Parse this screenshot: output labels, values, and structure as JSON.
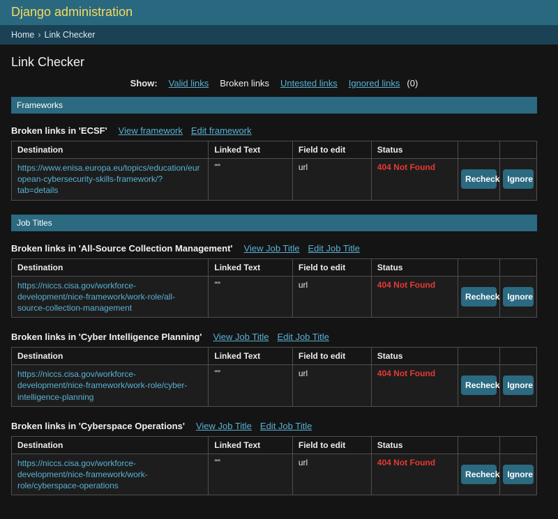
{
  "header": {
    "site_title": "Django administration"
  },
  "breadcrumb": {
    "home": "Home",
    "separator": "›",
    "current": "Link Checker"
  },
  "page": {
    "title": "Link Checker"
  },
  "filters": {
    "label": "Show:",
    "valid": "Valid links",
    "broken": "Broken links",
    "untested": "Untested links",
    "ignored": "Ignored links",
    "ignored_count": "(0)"
  },
  "table_headers": {
    "destination": "Destination",
    "linked_text": "Linked Text",
    "field_to_edit": "Field to edit",
    "status": "Status"
  },
  "buttons": {
    "recheck": "Recheck",
    "ignore": "Ignore"
  },
  "sections": [
    {
      "title": "Frameworks",
      "groups": [
        {
          "heading": "Broken links in 'ECSF'",
          "view_label": "View framework",
          "edit_label": "Edit framework",
          "row": {
            "destination": "https://www.enisa.europa.eu/topics/education/european-cybersecurity-skills-framework/?tab=details",
            "linked_text": "\"\"",
            "field": "url",
            "status": "404 Not Found"
          }
        }
      ]
    },
    {
      "title": "Job Titles",
      "groups": [
        {
          "heading": "Broken links in 'All-Source Collection Management'",
          "view_label": "View Job Title",
          "edit_label": "Edit Job Title",
          "row": {
            "destination": "https://niccs.cisa.gov/workforce-development/nice-framework/work-role/all-source-collection-management",
            "linked_text": "\"\"",
            "field": "url",
            "status": "404 Not Found"
          }
        },
        {
          "heading": "Broken links in 'Cyber Intelligence Planning'",
          "view_label": "View Job Title",
          "edit_label": "Edit Job Title",
          "row": {
            "destination": "https://niccs.cisa.gov/workforce-development/nice-framework/work-role/cyber-intelligence-planning",
            "linked_text": "\"\"",
            "field": "url",
            "status": "404 Not Found"
          }
        },
        {
          "heading": "Broken links in 'Cyberspace Operations'",
          "view_label": "View Job Title",
          "edit_label": "Edit Job Title",
          "row": {
            "destination": "https://niccs.cisa.gov/workforce-development/nice-framework/work-role/cyberspace-operations",
            "linked_text": "\"\"",
            "field": "url",
            "status": "404 Not Found"
          }
        }
      ]
    }
  ],
  "colors": {
    "header_bg": "#2a6880",
    "breadcrumb_bg": "#1a4254",
    "caption_bg": "#2b6a80",
    "brand_yellow": "#f5dd5d",
    "link_blue": "#58b2d4",
    "error_red": "#e53935",
    "body_bg": "#141414"
  }
}
